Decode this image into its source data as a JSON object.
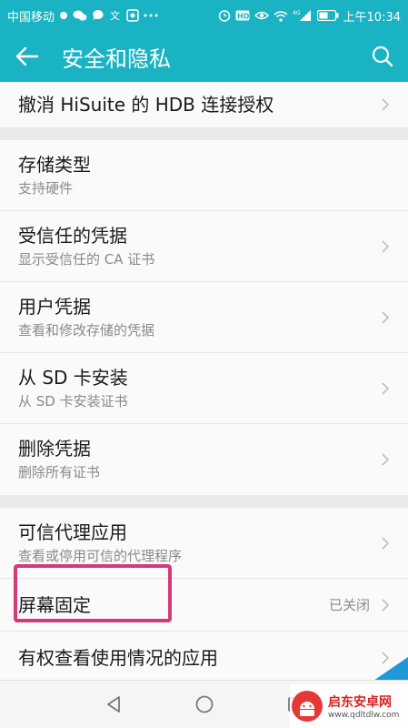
{
  "statusbar": {
    "carrier": "中国移动",
    "time": "上午10:34",
    "left_icons": [
      "location-dot-icon",
      "wechat-icon",
      "message-icon",
      "text-icon",
      "app-icon",
      "more-dots-icon"
    ],
    "right_icons": [
      "alarm-icon",
      "hd-icon",
      "eye-icon",
      "wifi-icon",
      "signal-icon",
      "battery-icon"
    ],
    "signal_label": "4G"
  },
  "appbar": {
    "title": "安全和隐私",
    "color": "#19b3c3"
  },
  "top_item": {
    "label": "撤消 HiSuite 的 HDB 连接授权"
  },
  "credential_group": [
    {
      "title": "存储类型",
      "subtitle": "支持硬件",
      "chevron": false
    },
    {
      "title": "受信任的凭据",
      "subtitle": "显示受信任的 CA 证书",
      "chevron": true
    },
    {
      "title": "用户凭据",
      "subtitle": "查看和修改存储的凭据",
      "chevron": true
    },
    {
      "title": "从 SD 卡安装",
      "subtitle": "从 SD 卡安装证书",
      "chevron": true
    },
    {
      "title": "删除凭据",
      "subtitle": "删除所有证书",
      "chevron": true
    }
  ],
  "advanced_group": {
    "trust_agent": {
      "title": "可信代理应用",
      "subtitle": "查看或停用可信的代理程序"
    },
    "screen_pin": {
      "title": "屏幕固定",
      "value": "已关闭"
    },
    "usage_access": {
      "title": "有权查看使用情况的应用"
    }
  },
  "highlight_color": "#d33a7c",
  "watermark": {
    "title": "启东安卓网",
    "url": "www.qdltdlw.com"
  }
}
